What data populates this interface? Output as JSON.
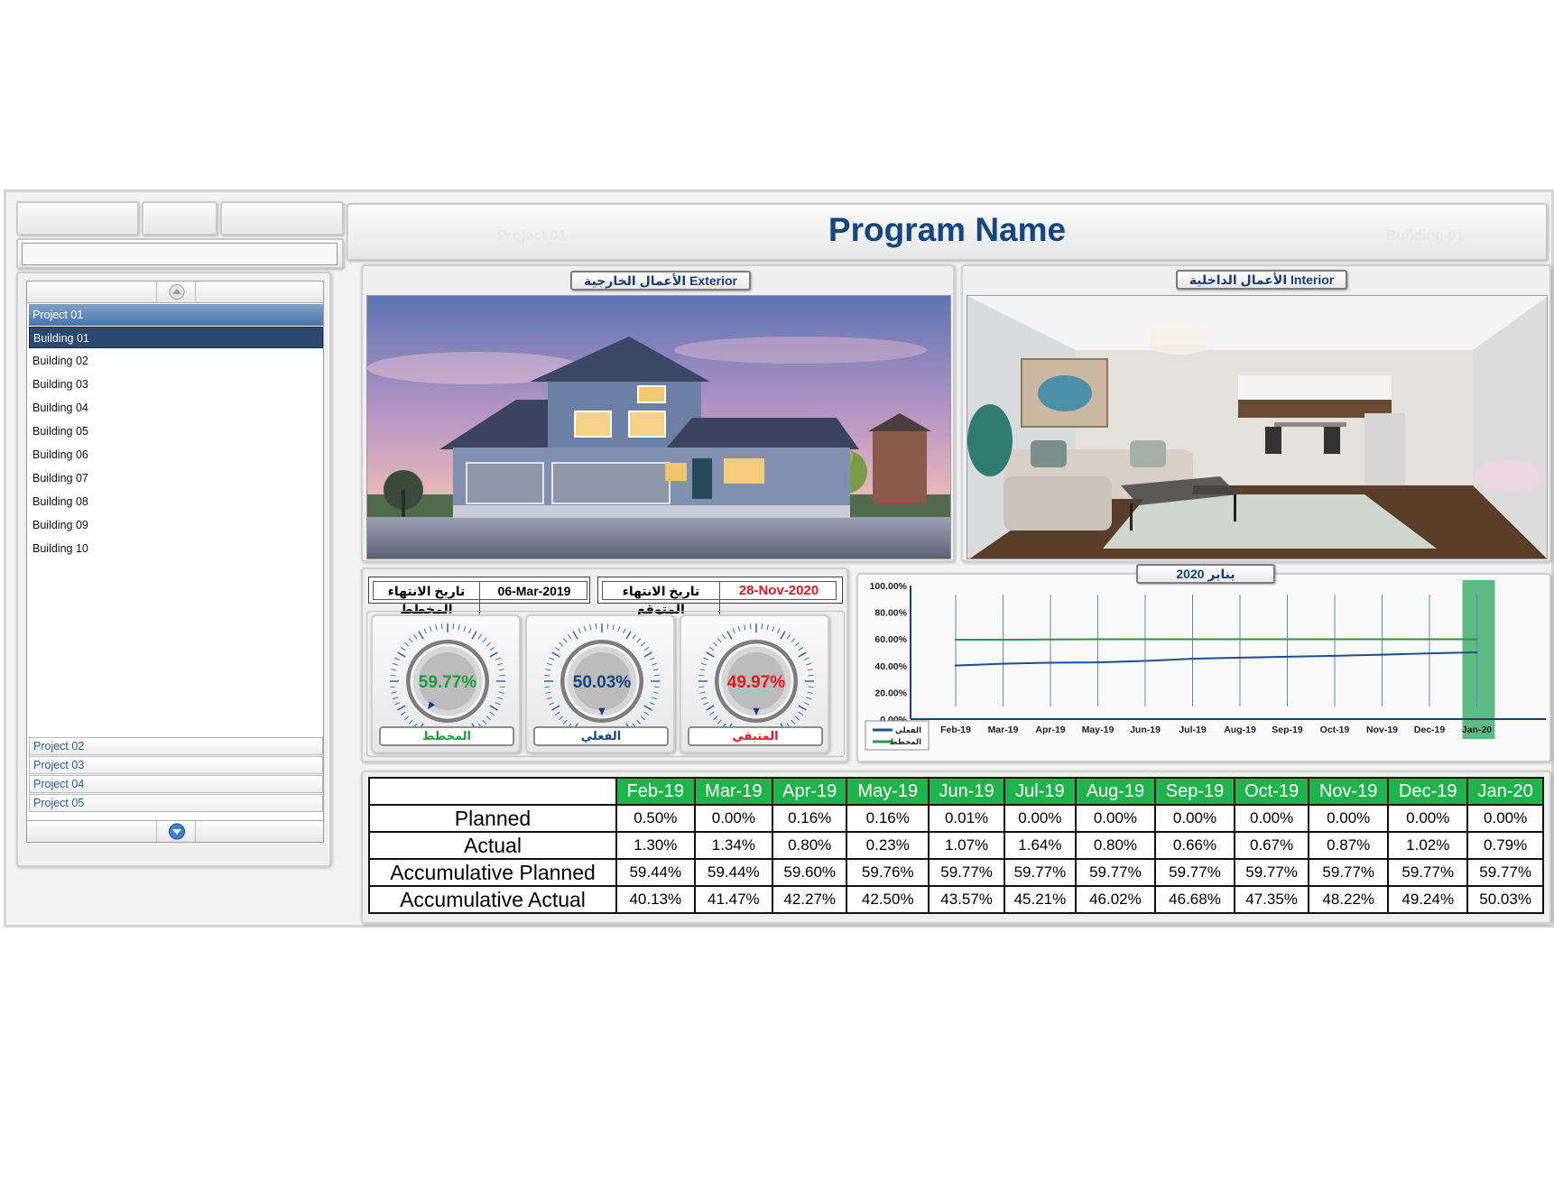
{
  "header": {
    "title": "Program Name",
    "ghost_project": "Project 01",
    "ghost_building": "Building 01"
  },
  "slicer": {
    "selected_project": "Project 01",
    "buildings": [
      "Building 01",
      "Building 02",
      "Building 03",
      "Building 04",
      "Building 05",
      "Building 06",
      "Building 07",
      "Building 08",
      "Building 09",
      "Building 10"
    ],
    "selected_building_index": 0,
    "other_projects": [
      "Project 02",
      "Project 03",
      "Project 04",
      "Project 05"
    ]
  },
  "panels": {
    "exterior_caption": "الأعمال الخارجية Exterior",
    "interior_caption": "الأعمال الداخلية Interior"
  },
  "dates": {
    "planned_finish_label": "تاريخ الانتهاء المخطط",
    "planned_finish_value": "06-Mar-2019",
    "expected_finish_label": "تاريخ الانتهاء المتوقع",
    "expected_finish_value": "28-Nov-2020"
  },
  "gauges": [
    {
      "value_text": "59.77%",
      "value": 59.77,
      "label": "المخطط",
      "color": "#1f9a3c"
    },
    {
      "value_text": "50.03%",
      "value": 50.03,
      "label": "الفعلي",
      "color": "#16467e"
    },
    {
      "value_text": "49.97%",
      "value": 49.97,
      "label": "المتبقي",
      "color": "#e0191f"
    }
  ],
  "chart_caption": "يناير 2020",
  "chart_data": {
    "type": "line",
    "categories": [
      "Feb-19",
      "Mar-19",
      "Apr-19",
      "May-19",
      "Jun-19",
      "Jul-19",
      "Aug-19",
      "Sep-19",
      "Oct-19",
      "Nov-19",
      "Dec-19",
      "Jan-20"
    ],
    "series": [
      {
        "name": "الفعلي",
        "values": [
          40.13,
          41.47,
          42.27,
          42.5,
          43.57,
          45.21,
          46.02,
          46.68,
          47.35,
          48.22,
          49.24,
          50.03
        ],
        "color": "#1f4e8c"
      },
      {
        "name": "المخطط",
        "values": [
          59.44,
          59.44,
          59.6,
          59.76,
          59.77,
          59.77,
          59.77,
          59.77,
          59.77,
          59.77,
          59.77,
          59.77
        ],
        "color": "#1f9a3c"
      }
    ],
    "yticks": [
      "100.00%",
      "80.00%",
      "60.00%",
      "40.00%",
      "20.00%",
      "0.00%"
    ],
    "ylim": [
      0,
      100
    ],
    "highlight_category": "Jan-20",
    "highlight_color": "#3fae6c",
    "legend_position": "bottom-left",
    "grid": "vertical"
  },
  "table": {
    "months": [
      "Feb-19",
      "Mar-19",
      "Apr-19",
      "May-19",
      "Jun-19",
      "Jul-19",
      "Aug-19",
      "Sep-19",
      "Oct-19",
      "Nov-19",
      "Dec-19",
      "Jan-20"
    ],
    "rows": [
      {
        "label": "Planned",
        "values": [
          "0.50%",
          "0.00%",
          "0.16%",
          "0.16%",
          "0.01%",
          "0.00%",
          "0.00%",
          "0.00%",
          "0.00%",
          "0.00%",
          "0.00%",
          "0.00%"
        ]
      },
      {
        "label": "Actual",
        "values": [
          "1.30%",
          "1.34%",
          "0.80%",
          "0.23%",
          "1.07%",
          "1.64%",
          "0.80%",
          "0.66%",
          "0.67%",
          "0.87%",
          "1.02%",
          "0.79%"
        ]
      },
      {
        "label": "Accumulative Planned",
        "values": [
          "59.44%",
          "59.44%",
          "59.60%",
          "59.76%",
          "59.77%",
          "59.77%",
          "59.77%",
          "59.77%",
          "59.77%",
          "59.77%",
          "59.77%",
          "59.77%"
        ]
      },
      {
        "label": "Accumulative Actual",
        "values": [
          "40.13%",
          "41.47%",
          "42.27%",
          "42.50%",
          "43.57%",
          "45.21%",
          "46.02%",
          "46.68%",
          "47.35%",
          "48.22%",
          "49.24%",
          "50.03%"
        ]
      }
    ],
    "header_color": "#1fb34b"
  }
}
